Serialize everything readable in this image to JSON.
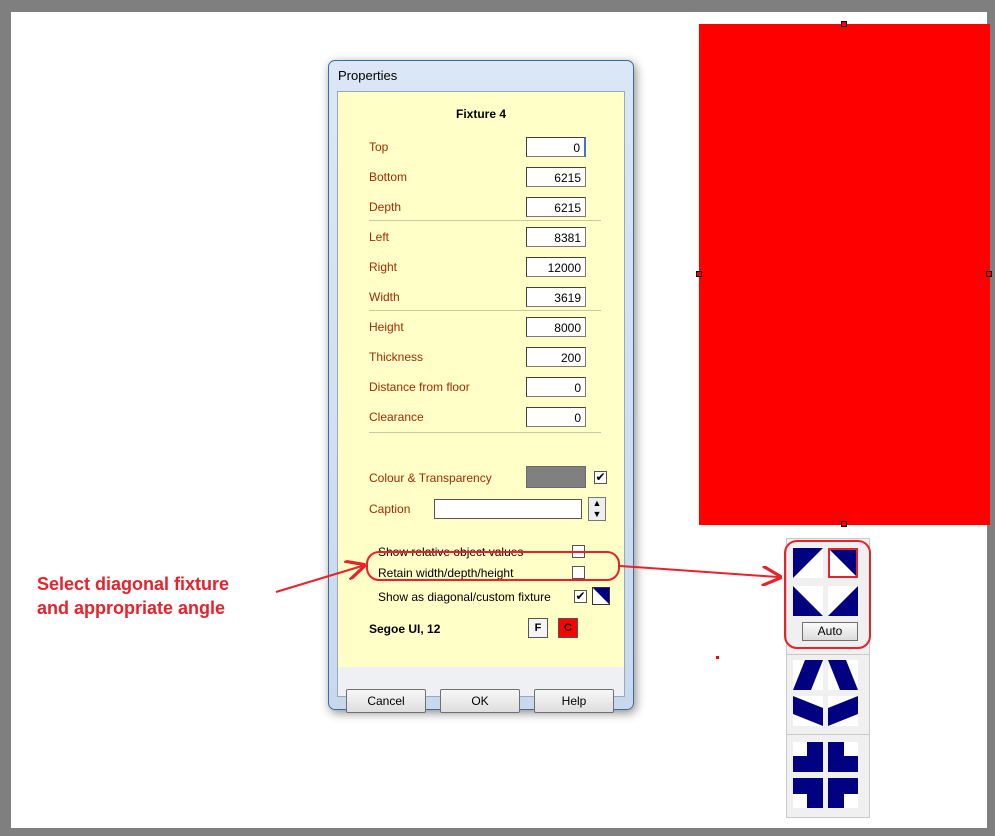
{
  "dialog": {
    "title": "Properties",
    "fixture_name": "Fixture 4",
    "fields": [
      {
        "label": "Top",
        "value": "0"
      },
      {
        "label": "Bottom",
        "value": "6215"
      },
      {
        "label": "Depth",
        "value": "6215"
      },
      {
        "label": "Left",
        "value": "8381"
      },
      {
        "label": "Right",
        "value": "12000"
      },
      {
        "label": "Width",
        "value": "3619"
      },
      {
        "label": "Height",
        "value": "8000"
      },
      {
        "label": "Thickness",
        "value": "200"
      },
      {
        "label": "Distance from floor",
        "value": "0"
      },
      {
        "label": "Clearance",
        "value": "0"
      }
    ],
    "colour_label": "Colour & Transparency",
    "colour_value": "#808080",
    "colour_checked": true,
    "caption_label": "Caption",
    "caption_value": "",
    "options": [
      {
        "label": "Show relative object values",
        "checked": false
      },
      {
        "label": "Retain width/depth/height",
        "checked": false
      },
      {
        "label": "Show as diagonal/custom fixture",
        "checked": true
      }
    ],
    "font_label": "Segoe UI, 12",
    "font_button": "F",
    "colour_button": "C",
    "buttons": {
      "cancel": "Cancel",
      "ok": "OK",
      "help": "Help"
    }
  },
  "picker": {
    "auto_label": "Auto"
  },
  "annotation": {
    "line1": "Select diagonal fixture",
    "line2": "and appropriate angle"
  },
  "colors": {
    "fixture": "#ff0000",
    "accent": "#e8212a",
    "icon": "#000080"
  }
}
